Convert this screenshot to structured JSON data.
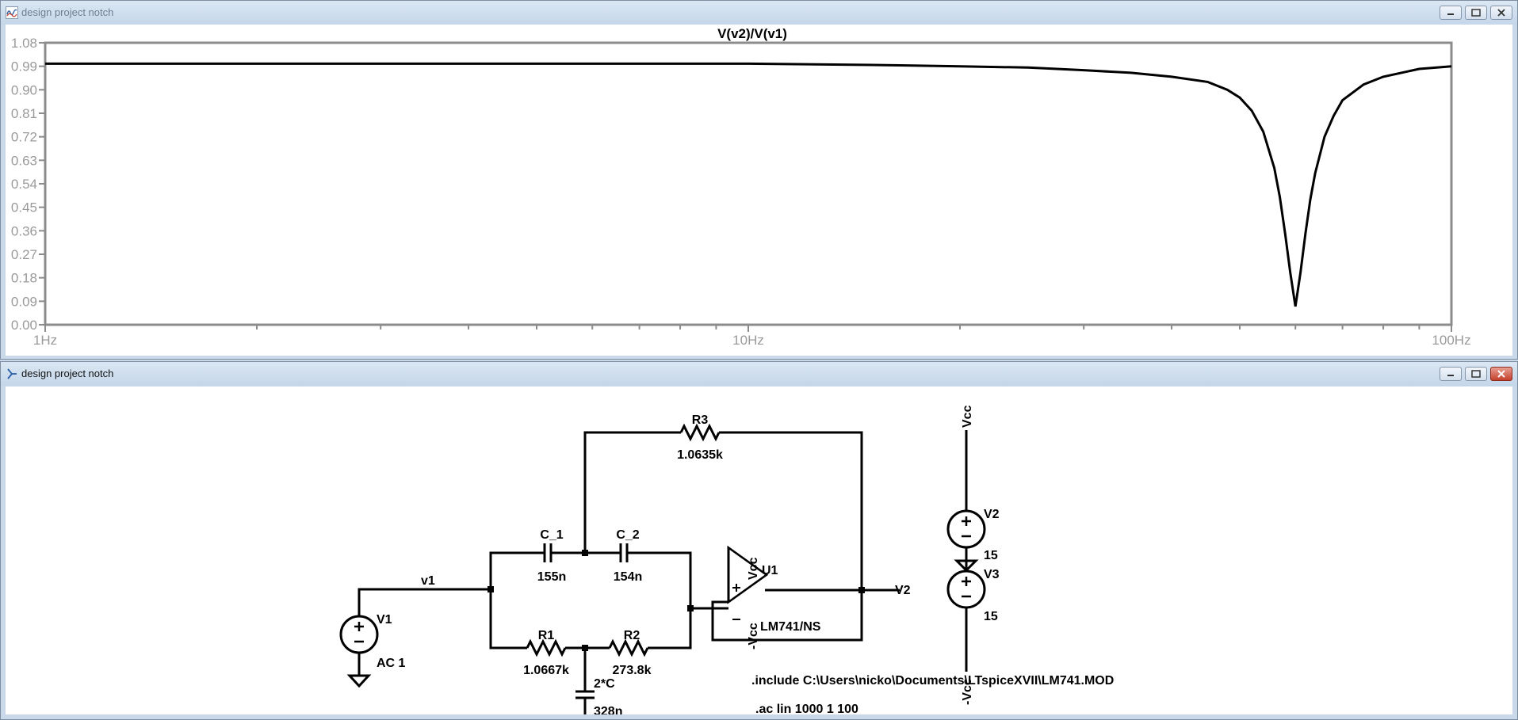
{
  "plot_window": {
    "title": "design project notch",
    "trace_title": "V(v2)/V(v1)",
    "colors": {
      "trace": "#000000",
      "axis": "#808080",
      "label": "#9a9a9a"
    }
  },
  "chart_data": {
    "type": "line",
    "title": "V(v2)/V(v1)",
    "xscale": "log",
    "xlim": [
      1,
      100
    ],
    "ylim": [
      0,
      1.08
    ],
    "x_ticks": [
      "1Hz",
      "10Hz",
      "100Hz"
    ],
    "y_ticks": [
      "0.00",
      "0.09",
      "0.18",
      "0.27",
      "0.36",
      "0.45",
      "0.54",
      "0.63",
      "0.72",
      "0.81",
      "0.90",
      "0.99",
      "1.08"
    ],
    "series": [
      {
        "x": [
          1,
          5,
          10,
          15,
          20,
          25,
          30,
          35,
          40,
          45,
          48,
          50,
          52,
          54,
          56,
          57,
          58,
          59,
          60,
          61,
          62,
          63,
          64,
          66,
          68,
          70,
          75,
          80,
          90,
          100
        ],
        "values": [
          1.0,
          1.0,
          1.0,
          0.995,
          0.99,
          0.985,
          0.975,
          0.965,
          0.95,
          0.93,
          0.9,
          0.87,
          0.82,
          0.74,
          0.6,
          0.49,
          0.35,
          0.2,
          0.07,
          0.2,
          0.35,
          0.48,
          0.58,
          0.72,
          0.8,
          0.86,
          0.92,
          0.95,
          0.98,
          0.99
        ]
      }
    ]
  },
  "schematic_window": {
    "title": "design project notch",
    "labels": {
      "r3": "R3",
      "r3_val": "1.0635k",
      "c1": "C_1",
      "c1_val": "155n",
      "c2": "C_2",
      "c2_val": "154n",
      "r1": "R1",
      "r1_val": "1.0667k",
      "r2": "R2",
      "r2_val": "273.8k",
      "c3": "2*C",
      "c3_val": "328n",
      "v1": "V1",
      "v1_val": "AC 1",
      "net_v1": "v1",
      "net_v2": "V2",
      "u1": "U1",
      "u1_model": "LM741/NS",
      "vcc_pos": "Vcc",
      "vcc_neg": "-Vcc",
      "v2src": "V2",
      "v2src_val": "15",
      "v3src": "V3",
      "v3src_val": "15",
      "top_vcc": "Vcc",
      "bot_vcc": "-Vcc",
      "directive_include": ".include C:\\Users\\nicko\\Documents\\LTspiceXVII\\LM741.MOD",
      "directive_ac": ".ac lin 1000 1 100"
    }
  }
}
